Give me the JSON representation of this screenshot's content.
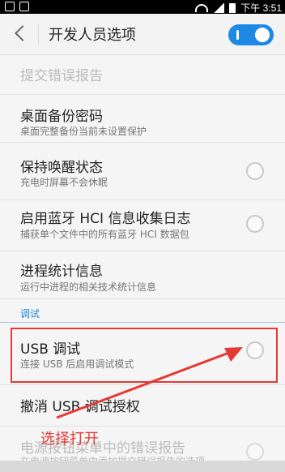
{
  "status_bar": {
    "time": "下午 3:51"
  },
  "header": {
    "title": "开发人员选项",
    "master_toggle": "on"
  },
  "items": [
    {
      "title": "提交错误报告",
      "disabled": true
    },
    {
      "title": "桌面备份密码",
      "subtitle": "桌面完整备份当前未设置保护"
    },
    {
      "title": "保持唤醒状态",
      "subtitle": "充电时屏幕不会休眠",
      "checked": false
    },
    {
      "title": "启用蓝牙 HCI 信息收集日志",
      "subtitle": "捕获单个文件中的所有蓝牙 HCI 数据包",
      "checked": false
    },
    {
      "title": "进程统计信息",
      "subtitle": "运行中进程的相关技术统计信息"
    }
  ],
  "section": {
    "label": "调试"
  },
  "debug_items": [
    {
      "title": "USB 调试",
      "subtitle": "连接 USB 后启用调试模式",
      "checked": false
    },
    {
      "title": "撤消 USB 调试授权"
    },
    {
      "title": "电源按钮菜单中的错误报告",
      "subtitle": "在电源按钮菜单中添加提交错误报告的选项",
      "disabled": true
    }
  ],
  "annotation": {
    "text": "选择打开",
    "color": "#e53935"
  },
  "colors": {
    "accent": "#1e88e5",
    "annotation_red": "#e53935"
  }
}
